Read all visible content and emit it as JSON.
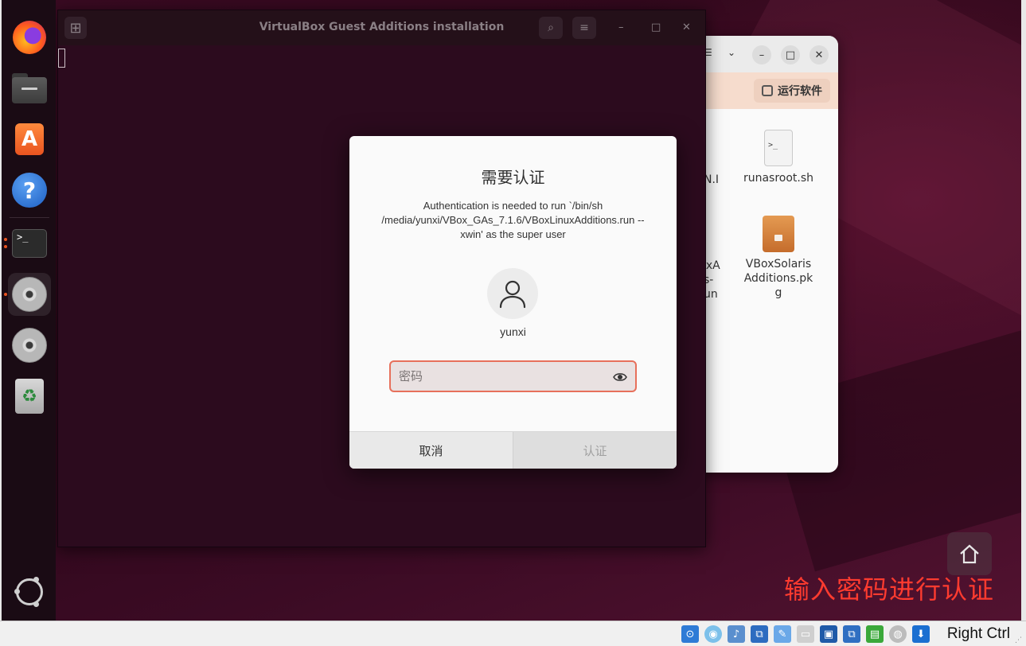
{
  "vm_desktop": {
    "terminal_window": {
      "title": "VirtualBox Guest Additions installation",
      "new_tab_icon": "new-tab-icon",
      "search_icon": "search-icon",
      "menu_icon": "hamburger-menu-icon"
    },
    "file_manager": {
      "run_software_label": "运行软件",
      "files": [
        {
          "name": "runasroot.sh",
          "icon": "shell-script-icon"
        },
        {
          "name": "VBoxSolarisAdditions.pkg",
          "icon": "package-icon"
        }
      ],
      "partial_labels": [
        "N.I",
        "uxA",
        "s-",
        "un"
      ]
    },
    "dock": {
      "items": [
        {
          "name": "firefox",
          "icon": "firefox-icon"
        },
        {
          "name": "files",
          "icon": "files-icon"
        },
        {
          "name": "app-center",
          "icon": "app-center-icon"
        },
        {
          "name": "help",
          "icon": "help-icon"
        },
        {
          "name": "terminal",
          "icon": "terminal-icon"
        },
        {
          "name": "vbox-disc-1",
          "icon": "optical-disc-icon"
        },
        {
          "name": "vbox-disc-2",
          "icon": "optical-disc-icon"
        },
        {
          "name": "trash",
          "icon": "trash-icon"
        },
        {
          "name": "show-apps",
          "icon": "ubuntu-logo-icon"
        }
      ]
    }
  },
  "auth_dialog": {
    "title": "需要认证",
    "message": "Authentication is needed to run `/bin/sh /media/yunxi/VBox_GAs_7.1.6/VBoxLinuxAdditions.run --xwin' as the super user",
    "username": "yunxi",
    "password_placeholder": "密码",
    "password_value": "",
    "cancel_label": "取消",
    "confirm_label": "认证"
  },
  "annotation_text": "输入密码进行认证",
  "vbox_status_bar": {
    "host_key_label": "Right Ctrl"
  },
  "colors": {
    "accent": "#e95420",
    "input_focus_border": "#e7705b",
    "annotation": "#ff3b2f"
  }
}
